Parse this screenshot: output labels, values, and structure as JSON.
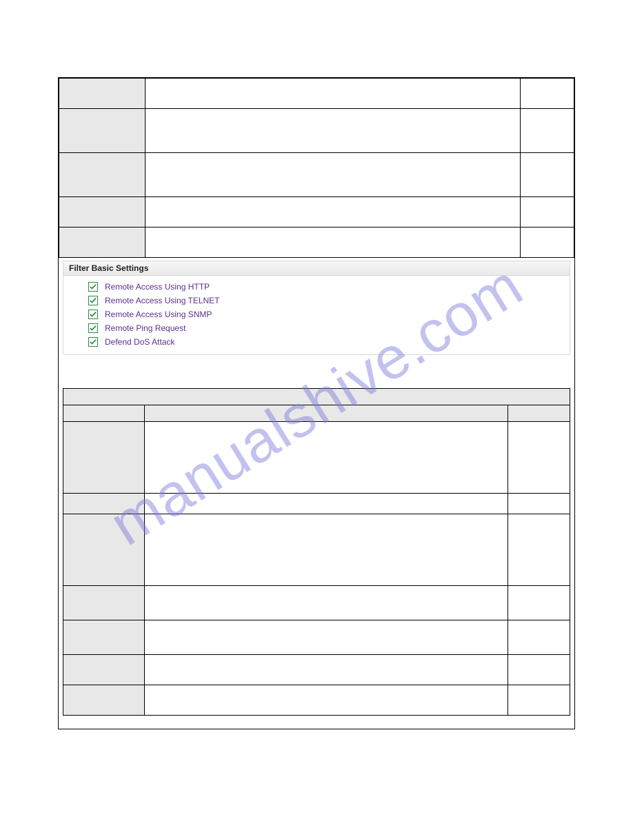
{
  "watermark": "manualshive.com",
  "filter": {
    "title": "Filter Basic Settings",
    "items": [
      {
        "label": "Remote Access Using HTTP",
        "checked": true
      },
      {
        "label": "Remote Access Using TELNET",
        "checked": true
      },
      {
        "label": "Remote Access Using SNMP",
        "checked": true
      },
      {
        "label": "Remote Ping Request",
        "checked": true
      },
      {
        "label": "Defend DoS Attack",
        "checked": true
      }
    ]
  },
  "table1_rows": [
    {
      "h": 44
    },
    {
      "h": 64
    },
    {
      "h": 64
    },
    {
      "h": 44
    },
    {
      "h": 44
    }
  ],
  "table2_rows": [
    {
      "h": 104
    },
    {
      "h": 30
    },
    {
      "h": 104
    },
    {
      "h": 50
    },
    {
      "h": 50
    },
    {
      "h": 44
    },
    {
      "h": 44
    }
  ]
}
